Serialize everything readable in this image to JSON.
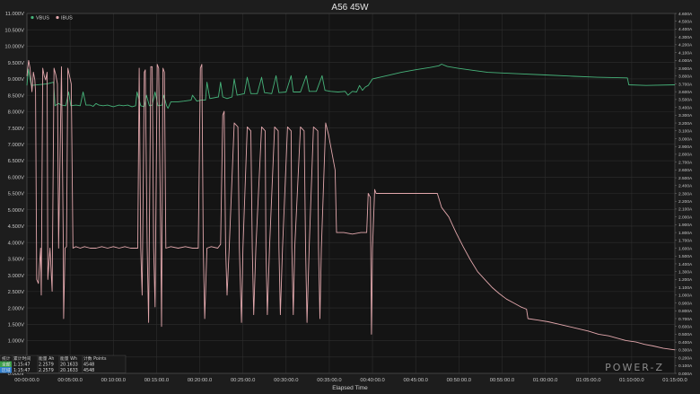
{
  "chart_data": {
    "type": "line",
    "title": "A56 45W",
    "xlabel": "Elapsed Time",
    "x_unit": "seconds",
    "xlim": [
      0,
      4500
    ],
    "x_ticks": [
      0,
      300,
      600,
      900,
      1200,
      1500,
      1800,
      2100,
      2400,
      2700,
      3000,
      3300,
      3600,
      3900,
      4200,
      4500
    ],
    "x_tick_labels": [
      "00:00:00.0",
      "00:05:00.0",
      "00:10:00.0",
      "00:15:00.0",
      "00:20:00.0",
      "00:25:00.0",
      "00:30:00.0",
      "00:35:00.0",
      "00:40:00.0",
      "00:45:00.0",
      "00:50:00.0",
      "00:55:00.0",
      "01:00:00.0",
      "01:05:00.0",
      "01:10:00.0",
      "01:15:00.0"
    ],
    "y_left": {
      "min": 0,
      "max": 11,
      "step": 0.5,
      "unit": "V",
      "decimals": 3
    },
    "y_right": {
      "min": 0,
      "max": 4.6,
      "step": 0.1,
      "unit": "A",
      "decimals": 3
    },
    "grid": true,
    "legend_position": "top-left",
    "series": [
      {
        "name": "VBUS",
        "color": "#46b37a",
        "axis": "left",
        "points": [
          [
            0,
            8.8
          ],
          [
            10,
            9.3
          ],
          [
            30,
            8.8
          ],
          [
            140,
            8.85
          ],
          [
            185,
            8.9
          ],
          [
            195,
            8.18
          ],
          [
            220,
            8.25
          ],
          [
            240,
            8.2
          ],
          [
            270,
            8.18
          ],
          [
            290,
            8.6
          ],
          [
            305,
            8.18
          ],
          [
            340,
            8.2
          ],
          [
            370,
            8.18
          ],
          [
            390,
            8.6
          ],
          [
            410,
            8.2
          ],
          [
            440,
            8.2
          ],
          [
            460,
            8.16
          ],
          [
            480,
            8.25
          ],
          [
            500,
            8.2
          ],
          [
            530,
            8.18
          ],
          [
            560,
            8.2
          ],
          [
            600,
            8.15
          ],
          [
            640,
            8.2
          ],
          [
            670,
            8.18
          ],
          [
            700,
            8.2
          ],
          [
            730,
            8.15
          ],
          [
            755,
            8.18
          ],
          [
            765,
            8.6
          ],
          [
            790,
            8.18
          ],
          [
            815,
            8.15
          ],
          [
            830,
            8.5
          ],
          [
            850,
            8.18
          ],
          [
            870,
            8.2
          ],
          [
            890,
            8.6
          ],
          [
            910,
            8.18
          ],
          [
            940,
            8.2
          ],
          [
            950,
            8.5
          ],
          [
            970,
            8.18
          ],
          [
            980,
            8.1
          ],
          [
            1000,
            8.3
          ],
          [
            1050,
            8.3
          ],
          [
            1090,
            8.32
          ],
          [
            1140,
            8.35
          ],
          [
            1150,
            8.5
          ],
          [
            1180,
            8.32
          ],
          [
            1210,
            8.35
          ],
          [
            1240,
            8.35
          ],
          [
            1250,
            8.9
          ],
          [
            1270,
            8.4
          ],
          [
            1330,
            8.45
          ],
          [
            1345,
            8.9
          ],
          [
            1360,
            8.45
          ],
          [
            1390,
            8.4
          ],
          [
            1425,
            8.45
          ],
          [
            1440,
            9.0
          ],
          [
            1460,
            8.5
          ],
          [
            1510,
            8.55
          ],
          [
            1530,
            9.05
          ],
          [
            1555,
            8.55
          ],
          [
            1600,
            8.55
          ],
          [
            1630,
            9.05
          ],
          [
            1650,
            8.58
          ],
          [
            1700,
            8.55
          ],
          [
            1730,
            9.1
          ],
          [
            1750,
            8.58
          ],
          [
            1800,
            8.6
          ],
          [
            1835,
            9.1
          ],
          [
            1850,
            8.6
          ],
          [
            1900,
            8.6
          ],
          [
            1940,
            9.1
          ],
          [
            1960,
            8.62
          ],
          [
            2010,
            8.62
          ],
          [
            2050,
            9.1
          ],
          [
            2070,
            8.65
          ],
          [
            2110,
            8.62
          ],
          [
            2160,
            8.6
          ],
          [
            2210,
            8.62
          ],
          [
            2230,
            8.5
          ],
          [
            2260,
            8.62
          ],
          [
            2290,
            8.6
          ],
          [
            2310,
            8.8
          ],
          [
            2330,
            8.65
          ],
          [
            2350,
            8.75
          ],
          [
            2370,
            8.8
          ],
          [
            2400,
            9.0
          ],
          [
            2500,
            9.1
          ],
          [
            2600,
            9.2
          ],
          [
            2700,
            9.28
          ],
          [
            2800,
            9.35
          ],
          [
            2860,
            9.4
          ],
          [
            2880,
            9.45
          ],
          [
            2920,
            9.38
          ],
          [
            3000,
            9.32
          ],
          [
            3100,
            9.26
          ],
          [
            3200,
            9.2
          ],
          [
            3400,
            9.16
          ],
          [
            3600,
            9.12
          ],
          [
            3800,
            9.08
          ],
          [
            3960,
            9.05
          ],
          [
            4170,
            9.03
          ],
          [
            4180,
            8.82
          ],
          [
            4300,
            8.8
          ],
          [
            4500,
            8.82
          ]
        ]
      },
      {
        "name": "IBUS",
        "color": "#e2a7ac",
        "axis": "right",
        "points": [
          [
            0,
            3.8
          ],
          [
            12,
            4.0
          ],
          [
            22,
            3.9
          ],
          [
            35,
            3.6
          ],
          [
            45,
            3.85
          ],
          [
            55,
            3.75
          ],
          [
            60,
            3.6
          ],
          [
            68,
            1.2
          ],
          [
            80,
            1.15
          ],
          [
            95,
            1.6
          ],
          [
            100,
            1.0
          ],
          [
            110,
            3.9
          ],
          [
            120,
            3.8
          ],
          [
            130,
            3.75
          ],
          [
            140,
            3.85
          ],
          [
            145,
            1.2
          ],
          [
            160,
            1.6
          ],
          [
            175,
            1.05
          ],
          [
            188,
            3.9
          ],
          [
            200,
            3.82
          ],
          [
            212,
            3.7
          ],
          [
            220,
            1.6
          ],
          [
            240,
            3.92
          ],
          [
            252,
            1.8
          ],
          [
            255,
            0.7
          ],
          [
            265,
            1.6
          ],
          [
            275,
            1.62
          ],
          [
            284,
            3.9
          ],
          [
            296,
            3.8
          ],
          [
            308,
            3.7
          ],
          [
            320,
            1.6
          ],
          [
            340,
            1.62
          ],
          [
            370,
            1.6
          ],
          [
            400,
            1.62
          ],
          [
            440,
            1.6
          ],
          [
            480,
            1.6
          ],
          [
            520,
            1.62
          ],
          [
            560,
            1.6
          ],
          [
            600,
            1.62
          ],
          [
            640,
            1.6
          ],
          [
            680,
            1.62
          ],
          [
            720,
            1.6
          ],
          [
            770,
            1.6
          ],
          [
            780,
            3.9
          ],
          [
            790,
            1.6
          ],
          [
            800,
            1.0
          ],
          [
            815,
            3.85
          ],
          [
            822,
            3.88
          ],
          [
            835,
            1.6
          ],
          [
            845,
            0.65
          ],
          [
            860,
            3.92
          ],
          [
            870,
            3.92
          ],
          [
            880,
            1.6
          ],
          [
            890,
            0.85
          ],
          [
            905,
            3.95
          ],
          [
            915,
            3.9
          ],
          [
            930,
            1.6
          ],
          [
            935,
            0.6
          ],
          [
            945,
            3.9
          ],
          [
            955,
            3.85
          ],
          [
            965,
            1.6
          ],
          [
            1000,
            1.62
          ],
          [
            1050,
            1.6
          ],
          [
            1100,
            1.62
          ],
          [
            1150,
            1.6
          ],
          [
            1190,
            1.6
          ],
          [
            1205,
            3.9
          ],
          [
            1215,
            3.95
          ],
          [
            1225,
            1.6
          ],
          [
            1235,
            0.7
          ],
          [
            1250,
            1.6
          ],
          [
            1280,
            1.62
          ],
          [
            1325,
            1.6
          ],
          [
            1345,
            1.65
          ],
          [
            1360,
            3.3
          ],
          [
            1370,
            3.35
          ],
          [
            1380,
            1.6
          ],
          [
            1390,
            1.0
          ],
          [
            1405,
            1.6
          ],
          [
            1440,
            3.2
          ],
          [
            1465,
            3.15
          ],
          [
            1475,
            1.6
          ],
          [
            1490,
            0.65
          ],
          [
            1500,
            1.6
          ],
          [
            1530,
            3.15
          ],
          [
            1555,
            3.1
          ],
          [
            1565,
            1.6
          ],
          [
            1575,
            0.75
          ],
          [
            1590,
            1.6
          ],
          [
            1630,
            3.15
          ],
          [
            1655,
            3.1
          ],
          [
            1660,
            1.6
          ],
          [
            1670,
            0.75
          ],
          [
            1685,
            1.6
          ],
          [
            1720,
            3.15
          ],
          [
            1745,
            3.1
          ],
          [
            1750,
            1.6
          ],
          [
            1760,
            0.75
          ],
          [
            1775,
            1.6
          ],
          [
            1810,
            3.15
          ],
          [
            1835,
            3.1
          ],
          [
            1840,
            1.6
          ],
          [
            1850,
            0.75
          ],
          [
            1860,
            1.6
          ],
          [
            1900,
            3.15
          ],
          [
            1925,
            3.1
          ],
          [
            1935,
            1.6
          ],
          [
            1945,
            0.65
          ],
          [
            1960,
            1.6
          ],
          [
            1990,
            3.15
          ],
          [
            2020,
            3.1
          ],
          [
            2025,
            1.6
          ],
          [
            2035,
            0.7
          ],
          [
            2045,
            1.6
          ],
          [
            2075,
            3.2
          ],
          [
            2095,
            3.05
          ],
          [
            2140,
            2.6
          ],
          [
            2150,
            1.8
          ],
          [
            2200,
            1.8
          ],
          [
            2260,
            1.78
          ],
          [
            2320,
            1.8
          ],
          [
            2360,
            1.8
          ],
          [
            2370,
            2.3
          ],
          [
            2385,
            2.25
          ],
          [
            2393,
            0.5
          ],
          [
            2400,
            1.6
          ],
          [
            2415,
            2.35
          ],
          [
            2425,
            2.3
          ],
          [
            2440,
            2.3
          ],
          [
            2600,
            2.3
          ],
          [
            2800,
            2.3
          ],
          [
            2850,
            2.3
          ],
          [
            2880,
            2.12
          ],
          [
            2930,
            2.0
          ],
          [
            2980,
            1.8
          ],
          [
            3030,
            1.62
          ],
          [
            3080,
            1.45
          ],
          [
            3130,
            1.3
          ],
          [
            3180,
            1.2
          ],
          [
            3230,
            1.1
          ],
          [
            3280,
            1.02
          ],
          [
            3330,
            0.95
          ],
          [
            3380,
            0.9
          ],
          [
            3430,
            0.85
          ],
          [
            3470,
            0.82
          ],
          [
            3480,
            0.7
          ],
          [
            3550,
            0.68
          ],
          [
            3620,
            0.66
          ],
          [
            3690,
            0.63
          ],
          [
            3760,
            0.6
          ],
          [
            3830,
            0.57
          ],
          [
            3900,
            0.54
          ],
          [
            3970,
            0.5
          ],
          [
            4040,
            0.48
          ],
          [
            4100,
            0.45
          ],
          [
            4160,
            0.42
          ],
          [
            4230,
            0.4
          ],
          [
            4290,
            0.37
          ],
          [
            4350,
            0.35
          ],
          [
            4420,
            0.32
          ],
          [
            4500,
            0.3
          ]
        ]
      }
    ]
  },
  "stats": {
    "headers": [
      "统计",
      "累计时间",
      "能量 Ah",
      "能量 Wh",
      "计数 Points"
    ],
    "rows": [
      {
        "label": "全部",
        "time": "1:15:47",
        "ah": "2.2579",
        "wh": "20.1633",
        "points": "4548",
        "color": "#3c9f4a"
      },
      {
        "label": "区域",
        "time": "1:15:47",
        "ah": "2.2579",
        "wh": "20.1633",
        "points": "4548",
        "color": "#2f7fd0"
      }
    ]
  },
  "brand": {
    "text": "POWER-Z"
  }
}
